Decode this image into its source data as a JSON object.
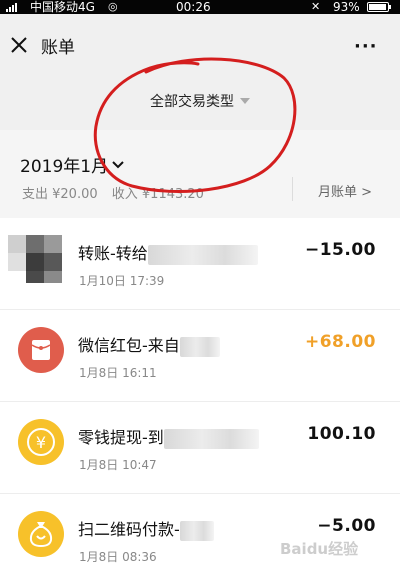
{
  "status_bar": {
    "carrier": "中国移动4G",
    "time": "00:26",
    "battery": "93%"
  },
  "header": {
    "title": "账单",
    "more": "···",
    "filter_label": "全部交易类型"
  },
  "month_section": {
    "month": "2019年1月",
    "expense": "支出 ¥20.00",
    "income": "收入 ¥1143.20",
    "monthly_bill": "月账单 >"
  },
  "transactions": [
    {
      "name": "转账-转给",
      "date": "1月10日 17:39",
      "amount": "−15.00",
      "icon": "mosaic-avatar"
    },
    {
      "name": "微信红包-来自",
      "date": "1月8日 16:11",
      "amount": "+68.00",
      "icon": "red-envelope-icon"
    },
    {
      "name": "零钱提现-到",
      "date": "1月8日 10:47",
      "amount": "100.10",
      "icon": "yen-coin-icon"
    },
    {
      "name": "扫二维码付款-",
      "date": "1月8日 08:36",
      "amount": "−5.00",
      "icon": "money-bag-icon"
    }
  ],
  "watermark": "Baidu经验",
  "colors": {
    "income": "#f0a028",
    "red_envelope": "#e05d4c",
    "coin": "#f7c12a"
  }
}
